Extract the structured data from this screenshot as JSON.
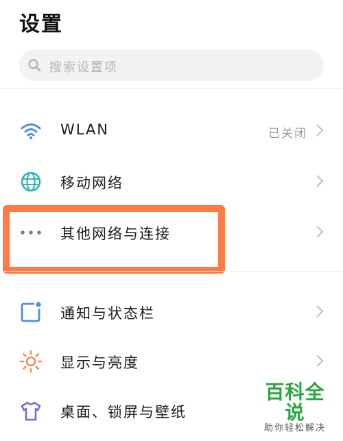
{
  "header": {
    "title": "设置"
  },
  "search": {
    "placeholder": "搜索设置项"
  },
  "settings": [
    {
      "label": "WLAN",
      "status": "已关闭",
      "icon": "wifi-icon"
    },
    {
      "label": "移动网络",
      "status": "",
      "icon": "globe-icon"
    },
    {
      "label": "其他网络与连接",
      "status": "",
      "icon": "more-dots-icon"
    },
    {
      "label": "通知与状态栏",
      "status": "",
      "icon": "notification-icon"
    },
    {
      "label": "显示与亮度",
      "status": "",
      "icon": "sun-icon"
    },
    {
      "label": "桌面、锁屏与壁纸",
      "status": "",
      "icon": "tshirt-icon"
    }
  ],
  "colors": {
    "accent_blue": "#4a90e2",
    "accent_teal": "#2fb5b3",
    "highlight_orange": "#ff7a45",
    "sun_orange": "#f58a5b",
    "purple": "#7b6ad6",
    "watermark_green": "#2aa640"
  },
  "watermark": {
    "title": "百科全说",
    "subtitle": "助你轻松解决"
  }
}
